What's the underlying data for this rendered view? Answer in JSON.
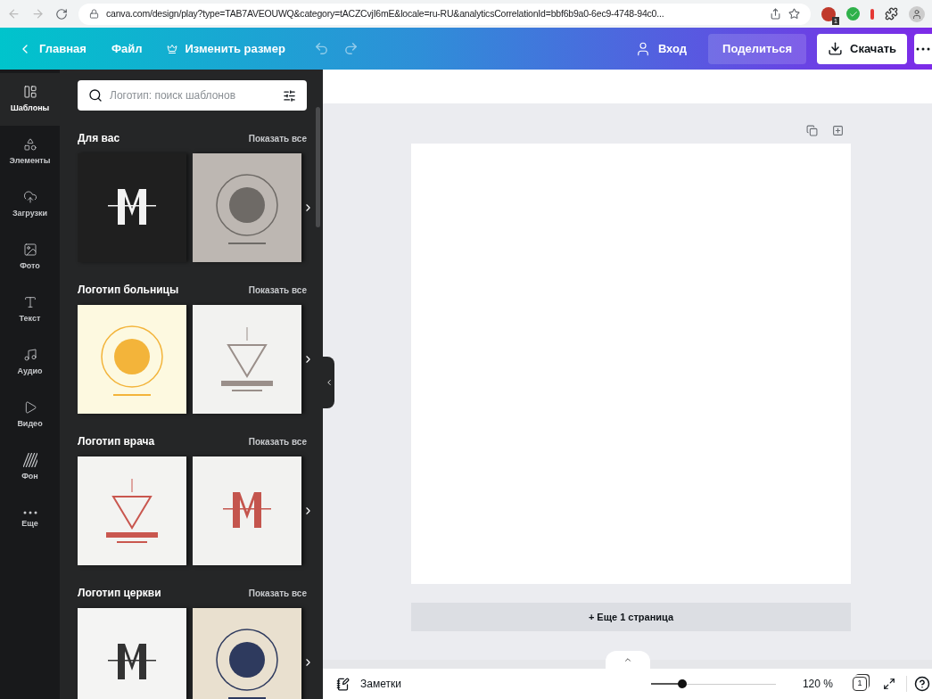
{
  "browser": {
    "url": "canva.com/design/play?type=TAB7AVEOUWQ&category=tACZCvjI6mE&locale=ru-RU&analyticsCorrelationId=bbf6b9a0-6ec9-4748-94c0...",
    "extension_badge": "1"
  },
  "topbar": {
    "back": "Главная",
    "file": "Файл",
    "resize": "Изменить размер",
    "login": "Вход",
    "share": "Поделиться",
    "download": "Скачать"
  },
  "rail": [
    {
      "kind": "templates",
      "label": "Шаблоны",
      "selected": true
    },
    {
      "kind": "elements",
      "label": "Элементы",
      "selected": false
    },
    {
      "kind": "uploads",
      "label": "Загрузки",
      "selected": false
    },
    {
      "kind": "photos",
      "label": "Фото",
      "selected": false
    },
    {
      "kind": "text",
      "label": "Текст",
      "selected": false
    },
    {
      "kind": "audio",
      "label": "Аудио",
      "selected": false
    },
    {
      "kind": "video",
      "label": "Видео",
      "selected": false
    },
    {
      "kind": "background",
      "label": "Фон",
      "selected": false
    },
    {
      "kind": "more",
      "label": "Еще",
      "selected": false
    }
  ],
  "search": {
    "placeholder": "Логотип: поиск шаблонов"
  },
  "sections": [
    {
      "title": "Для вас",
      "show_all": "Показать все"
    },
    {
      "title": "Логотип больницы",
      "show_all": "Показать все"
    },
    {
      "title": "Логотип врача",
      "show_all": "Показать все"
    },
    {
      "title": "Логотип церкви",
      "show_all": "Показать все"
    }
  ],
  "canvas": {
    "add_page": "+ Еще 1 страница"
  },
  "bottom_bar": {
    "notes": "Заметки",
    "zoom": {
      "level": 0.25,
      "reading": "120 %"
    },
    "page_count": "1"
  }
}
